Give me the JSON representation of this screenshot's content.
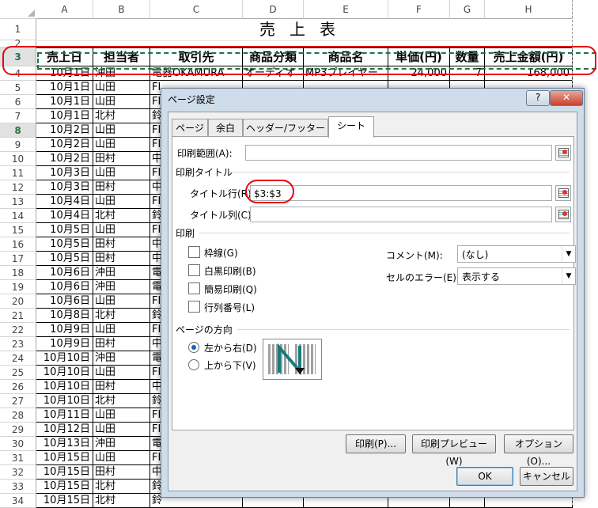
{
  "sheet": {
    "columns": [
      "A",
      "B",
      "C",
      "D",
      "E",
      "F",
      "G",
      "H"
    ],
    "title": "売上表",
    "headers": [
      "売上日",
      "担当者",
      "取引先",
      "商品分類",
      "商品名",
      "単価(円)",
      "数量",
      "売上金額(円)"
    ],
    "row_numbers": [
      "1",
      "2",
      "3",
      "4",
      "5",
      "6",
      "7",
      "8",
      "9",
      "10",
      "11",
      "12",
      "13",
      "14",
      "15",
      "16",
      "17",
      "18",
      "19",
      "20",
      "21",
      "22",
      "23",
      "24",
      "25",
      "26",
      "27",
      "28",
      "29",
      "30",
      "31",
      "32",
      "33",
      "34"
    ],
    "data_rows": [
      {
        "date": "10月1日",
        "rep": "沖田",
        "client": "電器OKAMURA",
        "cat": "オーディオ",
        "item": "MP3プレイヤー",
        "price": "24,000",
        "qty": "7",
        "amount": "168,000"
      },
      {
        "date": "10月1日",
        "rep": "山田",
        "client": "FI"
      },
      {
        "date": "10月1日",
        "rep": "山田",
        "client": "FI"
      },
      {
        "date": "10月1日",
        "rep": "北村",
        "client": "鈴"
      },
      {
        "date": "10月2日",
        "rep": "山田",
        "client": "FI"
      },
      {
        "date": "10月2日",
        "rep": "山田",
        "client": "FI"
      },
      {
        "date": "10月2日",
        "rep": "田村",
        "client": "中"
      },
      {
        "date": "10月3日",
        "rep": "山田",
        "client": "FI"
      },
      {
        "date": "10月3日",
        "rep": "田村",
        "client": "中"
      },
      {
        "date": "10月4日",
        "rep": "山田",
        "client": "FI"
      },
      {
        "date": "10月4日",
        "rep": "北村",
        "client": "鈴"
      },
      {
        "date": "10月5日",
        "rep": "山田",
        "client": "FI"
      },
      {
        "date": "10月5日",
        "rep": "田村",
        "client": "中"
      },
      {
        "date": "10月5日",
        "rep": "田村",
        "client": "中"
      },
      {
        "date": "10月6日",
        "rep": "沖田",
        "client": "電"
      },
      {
        "date": "10月6日",
        "rep": "沖田",
        "client": "電"
      },
      {
        "date": "10月6日",
        "rep": "山田",
        "client": "FI"
      },
      {
        "date": "10月8日",
        "rep": "北村",
        "client": "鈴"
      },
      {
        "date": "10月9日",
        "rep": "山田",
        "client": "FI"
      },
      {
        "date": "10月9日",
        "rep": "田村",
        "client": "中"
      },
      {
        "date": "10月10日",
        "rep": "沖田",
        "client": "電"
      },
      {
        "date": "10月10日",
        "rep": "山田",
        "client": "FI"
      },
      {
        "date": "10月10日",
        "rep": "田村",
        "client": "中"
      },
      {
        "date": "10月10日",
        "rep": "北村",
        "client": "鈴"
      },
      {
        "date": "10月11日",
        "rep": "山田",
        "client": "FI"
      },
      {
        "date": "10月12日",
        "rep": "山田",
        "client": "FI"
      },
      {
        "date": "10月13日",
        "rep": "沖田",
        "client": "電"
      },
      {
        "date": "10月15日",
        "rep": "山田",
        "client": "FI"
      },
      {
        "date": "10月15日",
        "rep": "田村",
        "client": "中"
      },
      {
        "date": "10月15日",
        "rep": "北村",
        "client": "鈴"
      },
      {
        "date": "10月15日",
        "rep": "北村",
        "client": "鈴"
      }
    ]
  },
  "dialog": {
    "title": "ページ設定",
    "help_label": "?",
    "close_label": "✕",
    "tabs": [
      "ページ",
      "余白",
      "ヘッダー/フッター",
      "シート"
    ],
    "print_area_label": "印刷範囲(A):",
    "print_area_value": "",
    "print_titles_group": "印刷タイトル",
    "title_rows_label": "タイトル行(R):",
    "title_rows_value": "$3:$3",
    "title_cols_label": "タイトル列(C):",
    "title_cols_value": "",
    "print_group": "印刷",
    "checkboxes": [
      "枠線(G)",
      "白黒印刷(B)",
      "簡易印刷(Q)",
      "行列番号(L)"
    ],
    "comments_label": "コメント(M):",
    "comments_value": "(なし)",
    "cell_errors_label": "セルのエラー(E):",
    "cell_errors_value": "表示する",
    "page_order_group": "ページの方向",
    "radio_left_right": "左から右(D)",
    "radio_top_bottom": "上から下(V)",
    "print_button": "印刷(P)...",
    "preview_button": "印刷プレビュー(W)",
    "options_button": "オプション(O)...",
    "ok_button": "OK",
    "cancel_button": "キャンセル"
  },
  "colors": {
    "accent": "#217346",
    "highlight": "#e60012"
  }
}
